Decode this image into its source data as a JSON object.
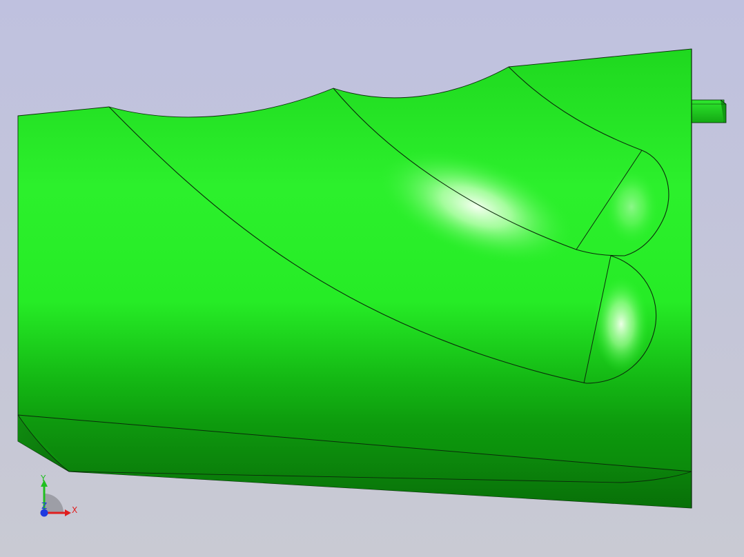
{
  "viewport": {
    "background_top": "#bfc1df",
    "background_bottom": "#c8c9d2",
    "part_color": "#22ee22",
    "part_dark": "#0a8a0a",
    "edge_color": "#0b2a0b",
    "highlight_color": "#f2ffee"
  },
  "triad": {
    "x_label": "X",
    "y_label": "Y",
    "z_label": "Z",
    "x_color": "#e01e1e",
    "y_color": "#1fbf1f",
    "z_color": "#1e3ae0"
  }
}
